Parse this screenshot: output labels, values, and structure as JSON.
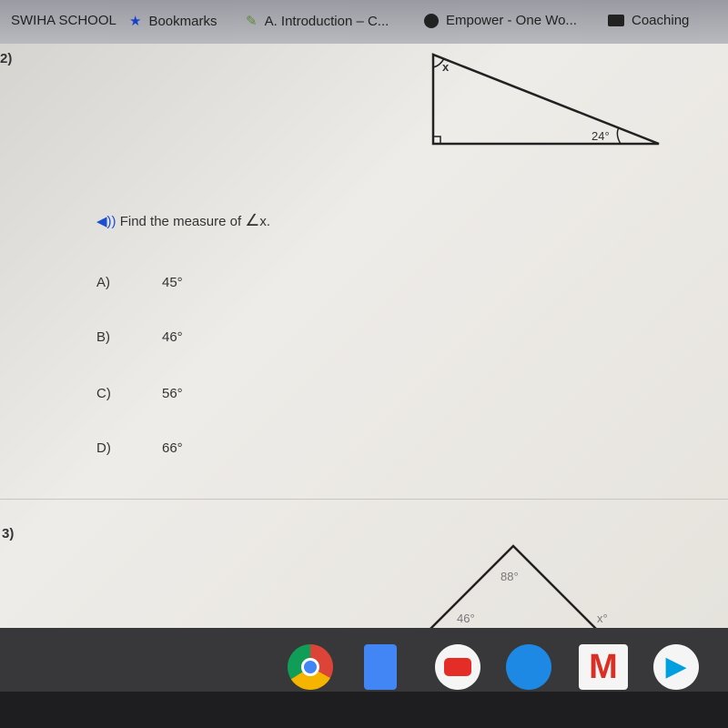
{
  "bookmarks": [
    {
      "label": "SWIHA SCHOOL",
      "icon": "page-icon"
    },
    {
      "label": "Bookmarks",
      "icon": "star-icon"
    },
    {
      "label": "A. Introduction – C...",
      "icon": "bookmark-favicon"
    },
    {
      "label": "Empower - One Wo...",
      "icon": "globe-icon"
    },
    {
      "label": "Coaching",
      "icon": "folder-icon"
    }
  ],
  "q2": {
    "number": "2)",
    "prompt": "Find the measure of",
    "angle_label": "x.",
    "fig_x": "x",
    "fig_angle": "24°",
    "choices": [
      {
        "letter": "A)",
        "value": "45°"
      },
      {
        "letter": "B)",
        "value": "46°"
      },
      {
        "letter": "C)",
        "value": "56°"
      },
      {
        "letter": "D)",
        "value": "66°"
      }
    ]
  },
  "q3": {
    "number": "3)",
    "angles": [
      "88°",
      "46°",
      "x°"
    ]
  },
  "shelf": [
    "chrome",
    "docs",
    "youtube",
    "messages",
    "gmail",
    "play-store"
  ]
}
